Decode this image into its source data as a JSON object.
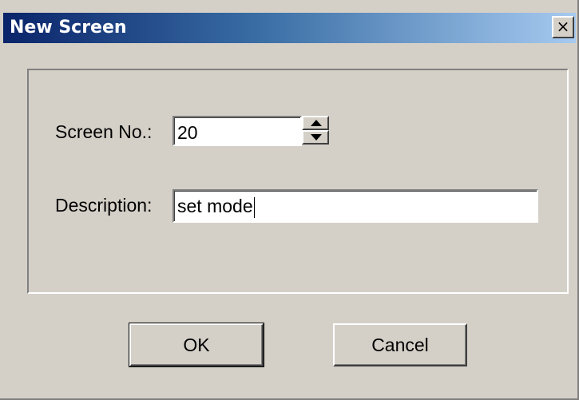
{
  "dialog": {
    "title": "New Screen",
    "close_symbol": "×"
  },
  "form": {
    "screen_no_label": "Screen No.:",
    "screen_no_value": "20",
    "description_label": "Description:",
    "description_value": "set mode"
  },
  "buttons": {
    "ok_label": "OK",
    "cancel_label": "Cancel"
  },
  "icons": {
    "spin_up": "spin-up-icon",
    "spin_down": "spin-down-icon",
    "close": "close-icon"
  },
  "colors": {
    "titlebar_start": "#0a246a",
    "titlebar_end": "#a6caf0",
    "dialog_face": "#d4d0c8"
  }
}
